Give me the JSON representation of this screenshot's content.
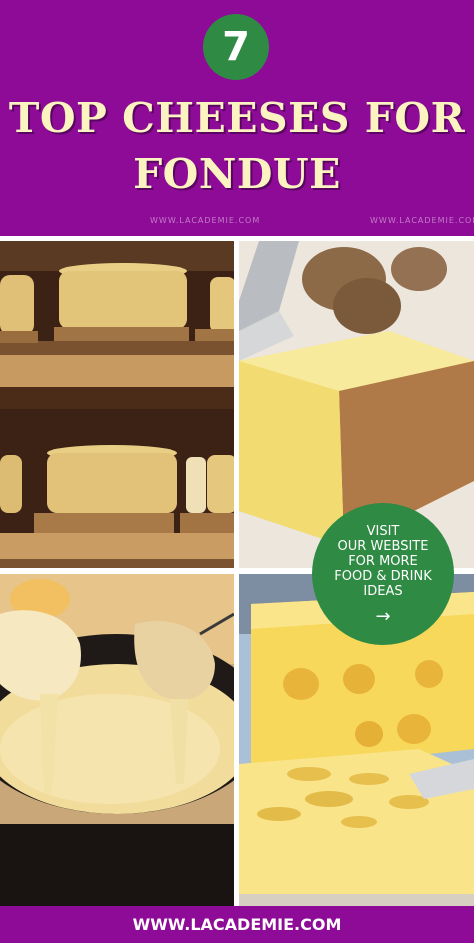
{
  "header": {
    "badge_number": "7",
    "title_line1": "TOP CHEESES FOR",
    "title_line2": "FONDUE",
    "watermark": "WWW.LACADEMIE.COM"
  },
  "cta": {
    "line1": "VISIT",
    "line2": "OUR WEBSITE",
    "line3": "FOR MORE",
    "line4": "FOOD & DRINK",
    "line5": "IDEAS",
    "arrow": "→"
  },
  "footer": {
    "url": "WWW.LACADEMIE.COM"
  },
  "colors": {
    "brand_purple": "#8e0b98",
    "title_cream": "#fbf3c0",
    "cta_green": "#2f8a44"
  }
}
